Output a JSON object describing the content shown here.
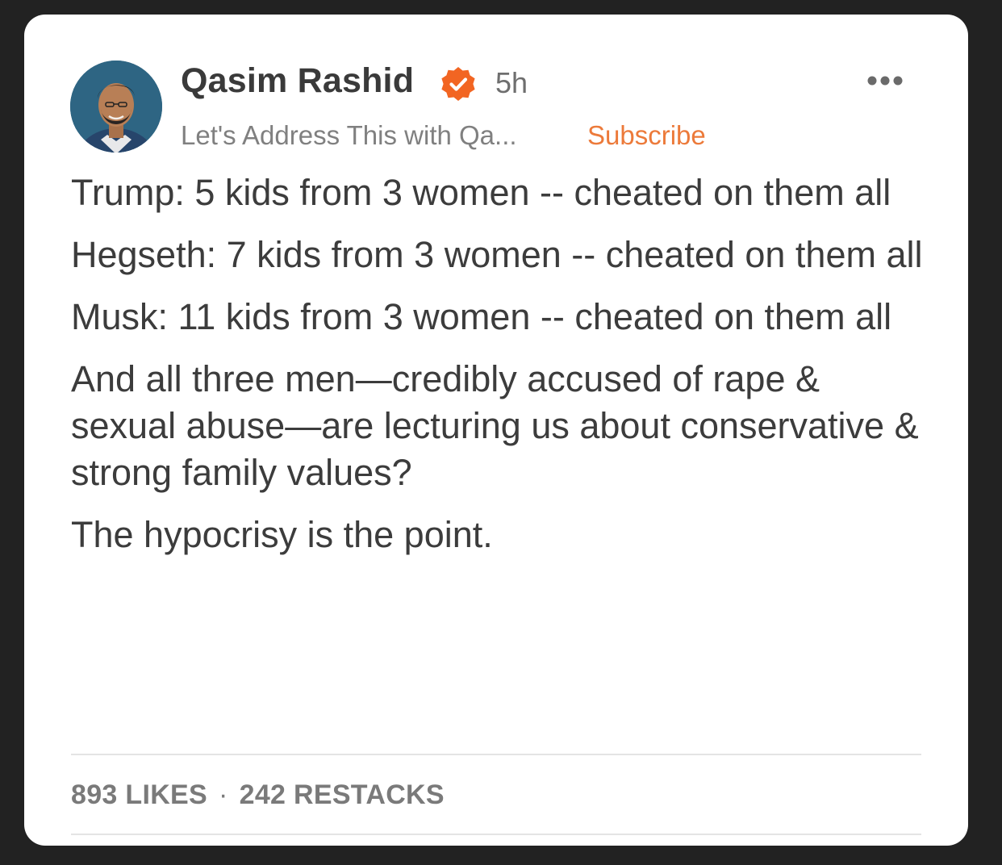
{
  "post": {
    "author_name": "Qasim Rashid",
    "time_ago": "5h",
    "publication": "Let's Address This with Qa...",
    "subscribe_label": "Subscribe",
    "paragraphs": [
      "Trump: 5 kids from 3 women -- cheated on them all",
      "Hegseth: 7 kids from 3 women -- cheated on them all",
      "Musk: 11 kids from 3 women -- cheated on them all",
      "And all three men—credibly accused of rape & sexual abuse—are lecturing us about conservative & strong family values?",
      "The hypocrisy is the point."
    ],
    "likes": "893 LIKES",
    "separator": "·",
    "restacks": "242 RESTACKS"
  },
  "icons": {
    "verified": "verified-badge-icon",
    "more": "more-options-icon"
  },
  "colors": {
    "background": "#222222",
    "card": "#ffffff",
    "accent": "#ec7a3a",
    "text": "#3c3c3c"
  }
}
